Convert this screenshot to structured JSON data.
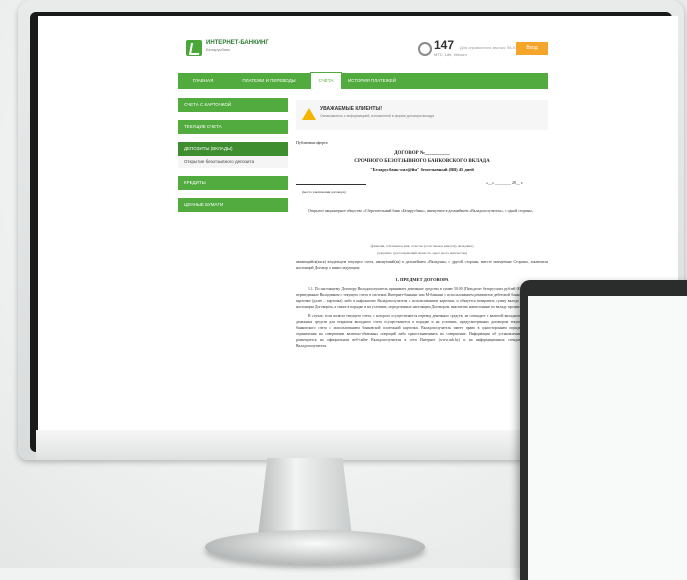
{
  "header": {
    "brand_title": "ИНТЕРНЕТ-БАНКИНГ",
    "brand_subtitle": "Беларусбанк",
    "phone": "147",
    "phone_subtitle": "МТС, Life, Velcom",
    "header_note": "Для справочного звонка: 98-97",
    "login_label": "Вход"
  },
  "nav": {
    "tabs": [
      {
        "label": "ГЛАВНАЯ"
      },
      {
        "label": "ПЛАТЕЖИ И ПЕРЕВОДЫ"
      },
      {
        "label": "СЧЕТА"
      },
      {
        "label": "ИСТОРИЯ ПЛАТЕЖЕЙ"
      }
    ]
  },
  "sidebar": {
    "items": [
      {
        "label": "СЧЕТА С КАРТОЧКОЙ"
      },
      {
        "label": "ТЕКУЩИЕ СЧЕТА"
      },
      {
        "label": "ДЕПОЗИТЫ (ВКЛАДЫ)"
      },
      {
        "label": "КРЕДИТЫ"
      },
      {
        "label": "ЦЕННЫЕ БУМАГИ"
      }
    ],
    "open_sub_item": "Открытие безотзывного депозита"
  },
  "notice": {
    "title": "УВАЖАЕМЫЕ КЛИЕНТЫ!",
    "text": "Ознакомьтесь с информацией, изложенной в форме договора вклада"
  },
  "document": {
    "tag": "Публичная оферта",
    "title_line1": "ДОГОВОР №__________",
    "title_line2": "СРОЧНОГО БЕЗОТЗЫВНОГО БАНКОВСКОГО ВКЛАДА",
    "title_line3": "\"Беларусбанк-онл@йн\" безотзывный (BB) 45 дней",
    "date_line": "«__» ________ 20__ г.",
    "place_caption": "(место заключения договора)",
    "para1": "Открытое акционерное общество «Сберегательный банк «Беларусбанк», именуемое в дальнейшем «Вкладополучатель», с одной стороны,",
    "caption1": "(фамилия, собственное имя, отчество (если таковое имеется), вкладчика)",
    "caption2": "(документ, удостоверяющий личность, адрес места жительства)",
    "para2": "являющийся(аяся) владельцем текущего счета, именуемый(ая) в дальнейшем «Вкладчик» с другой стороны, вместе именуемые Стороны, заключили настоящий Договор о нижеследующем:",
    "section_title": "1. ПРЕДМЕТ ДОГОВОРА",
    "para3": "1.1. По настоящему Договору Вкладополучатель принимает денежные средства в сумме 50.00 (Пятьдесят белорусских рублей 00 копеек) – вклад, переведенные Вкладчиком с текущего счета в системах Интернет-банкинг или М-банкинг с использованием реквизитов дебетовой банковской платежной карточки (далее – карточка) либо в инфокиоске Вкладополучателя с использованием карточки, и обязуется возвратить сумму вклада в соответствии с настоящим Договором, а также в порядке и на условиях, определенных настоящим Договором, выплатить начисленные по вкладу проценты.",
    "para4": "В случае, если валюта текущего счета, с которого осуществляется перевод денежных средств, не совпадает с валютой вкладного счета, списание денежных средств для открытия вкладного счета осуществляется в порядке и на условиях, предусмотренных договором текущего (расчетного) банковского счета с использованием банковской платежной карточки. Вкладополучатель имеет право в одностороннем порядке устанавливать ограничения на совершение валютно-обменных операций либо приостанавливать их совершение. Информация об установленных ограничениях размещается на официальном веб-сайте Вкладополучателя в сети Интернет (www.asb.by) и на информационных стендах подразделений Вкладополучателя."
  },
  "colors": {
    "accent_green": "#52ab3e",
    "dark_green": "#3e8d2f",
    "login_orange": "#f4a62a",
    "warning_yellow": "#f5b400"
  }
}
